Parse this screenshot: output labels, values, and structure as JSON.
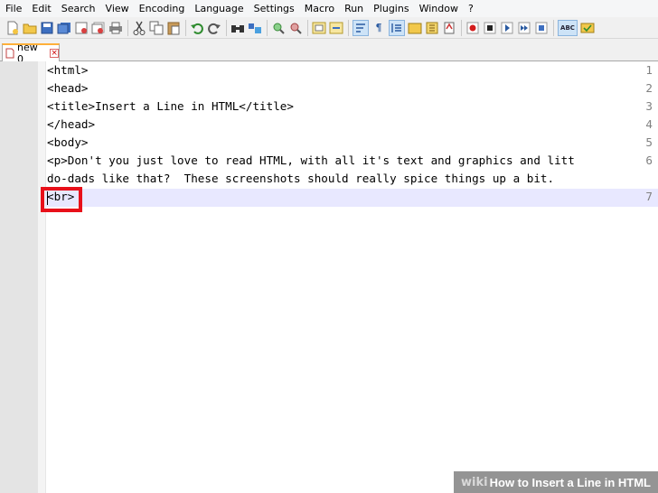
{
  "menu": [
    "File",
    "Edit",
    "Search",
    "View",
    "Encoding",
    "Language",
    "Settings",
    "Macro",
    "Run",
    "Plugins",
    "Window",
    "?"
  ],
  "tab": {
    "label": "new  0"
  },
  "editor": {
    "line_numbers": [
      "1",
      "2",
      "3",
      "4",
      "5",
      "6",
      "",
      "7"
    ],
    "lines": [
      "<html>",
      "<head>",
      "<title>Insert a Line in HTML</title>",
      "</head>",
      "<body>",
      "<p>Don't you just love to read HTML, with all it's text and graphics and litt",
      "do-dads like that?  These screenshots should really spice things up a bit.",
      "<br>"
    ],
    "current_line": 7
  },
  "watermark": {
    "brand": "wiki",
    "title": "How to Insert a Line in HTML"
  },
  "colors": {
    "highlight_box": "#e8101a",
    "current_line": "#e8e8ff",
    "tab_accent": "#ffb03a"
  }
}
